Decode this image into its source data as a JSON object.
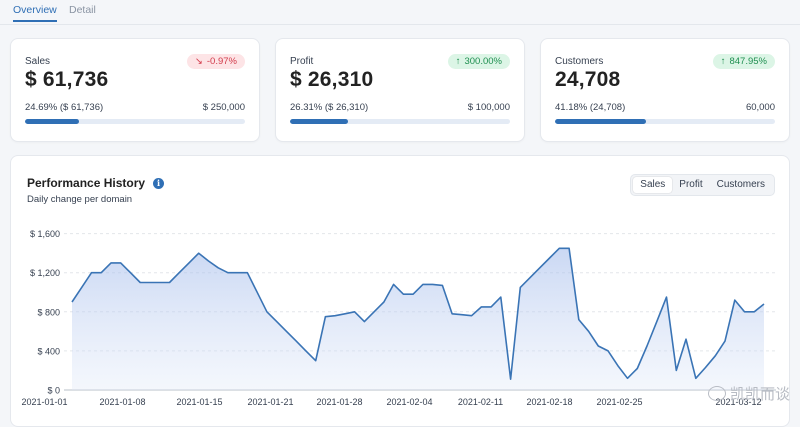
{
  "tabs": [
    {
      "label": "Overview"
    },
    {
      "label": "Detail"
    }
  ],
  "cards": [
    {
      "label": "Sales",
      "value": "$ 61,736",
      "badge": "-0.97%",
      "direction": "down",
      "percent_text": "24.69% ($ 61,736)",
      "target": "$ 250,000",
      "progress": 0.2469
    },
    {
      "label": "Profit",
      "value": "$ 26,310",
      "badge": "300.00%",
      "direction": "up",
      "percent_text": "26.31% ($ 26,310)",
      "target": "$ 100,000",
      "progress": 0.2631
    },
    {
      "label": "Customers",
      "value": "24,708",
      "badge": "847.95%",
      "direction": "up",
      "percent_text": "41.18% (24,708)",
      "target": "60,000",
      "progress": 0.4118
    }
  ],
  "panel": {
    "title": "Performance History",
    "info_icon": "info-icon",
    "subtitle": "Daily change per domain",
    "segments": [
      "Sales",
      "Profit",
      "Customers"
    ],
    "selected_segment": "Sales"
  },
  "chart_data": {
    "type": "area",
    "x_labels": [
      "2021-01-01",
      "2021-01-08",
      "2021-01-15",
      "2021-01-21",
      "2021-01-28",
      "2021-02-04",
      "2021-02-11",
      "2021-02-18",
      "2021-02-25",
      "2021-03-12"
    ],
    "y_tick_labels": [
      "$ 1,600",
      "$ 1,200",
      "$ 800",
      "$ 400",
      "$ 0"
    ],
    "ylim": [
      0,
      1700
    ],
    "grid": true,
    "color": "#3a74b5",
    "series": [
      {
        "values": [
          900,
          1050,
          1200,
          1200,
          1300,
          1300,
          1200,
          1100,
          1100,
          1100,
          1100,
          1200,
          1300,
          1400,
          1320,
          1250,
          1200,
          1200,
          1200,
          1000,
          800,
          700,
          600,
          500,
          400,
          300,
          750,
          760,
          780,
          800,
          700,
          800,
          900,
          1080,
          980,
          980,
          1080,
          1080,
          1070,
          780,
          770,
          760,
          850,
          850,
          950,
          110,
          1050,
          1150,
          1250,
          1350,
          1450,
          1450,
          720,
          600,
          450,
          400,
          250,
          120,
          220,
          450,
          700,
          950,
          200,
          520,
          120,
          230,
          350,
          500,
          920,
          800,
          800,
          880
        ]
      }
    ]
  },
  "watermark": "凯凯而谈",
  "colors": {
    "accent": "#2f6fb5",
    "down": "#d23b4b",
    "up": "#1f8f50"
  }
}
